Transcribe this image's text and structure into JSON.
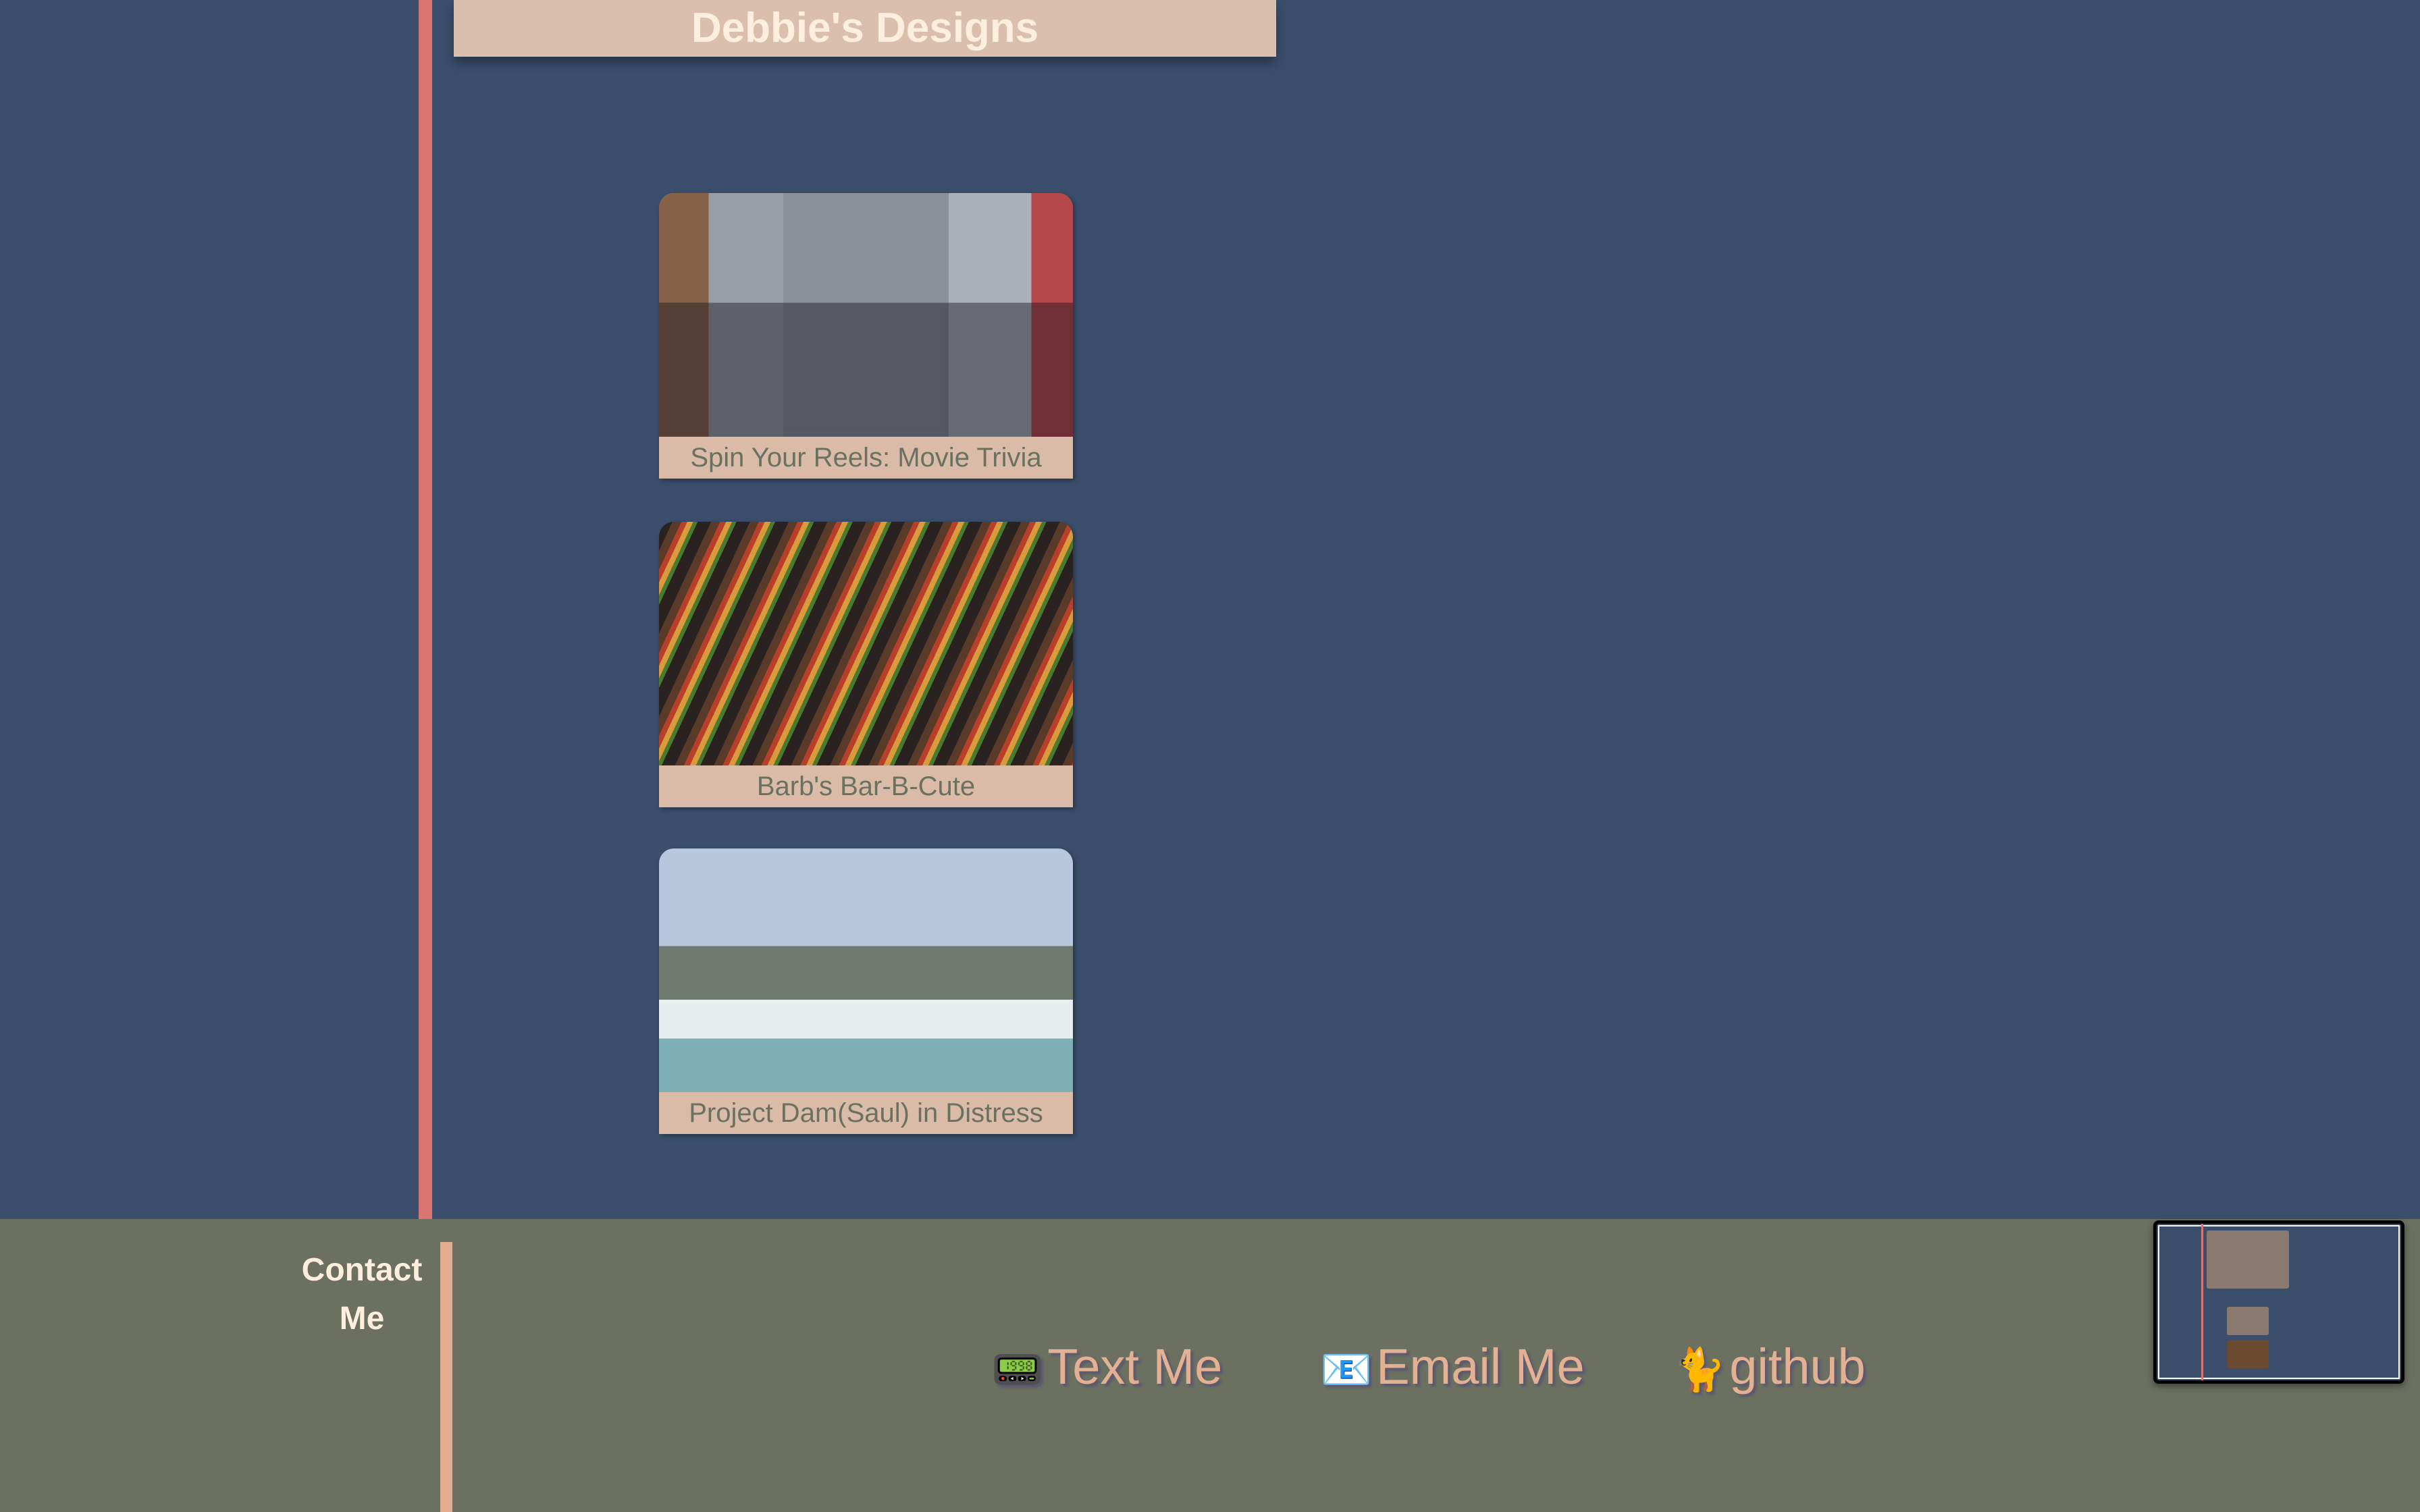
{
  "header": {
    "title": "Debbie's Designs"
  },
  "projects": [
    {
      "title": "Spin Your Reels: Movie Trivia",
      "image": "friends-toasting-photo"
    },
    {
      "title": "Barb's Bar-B-Cute",
      "image": "grill-kebabs-photo"
    },
    {
      "title": "Project Dam(Saul) in Distress",
      "image": "dam-waterfall-photo"
    }
  ],
  "footer": {
    "contact_heading": "Contact Me",
    "links": [
      {
        "icon": "📟",
        "label": "Text Me"
      },
      {
        "icon": "📧",
        "label": "Email Me"
      },
      {
        "icon": "🐈",
        "label": "github"
      }
    ]
  },
  "colors": {
    "background": "#3b4f6d",
    "accent": "#d97674",
    "footer": "#6b7060",
    "link": "#e4b093",
    "caption_bg": "#d9bba7"
  }
}
